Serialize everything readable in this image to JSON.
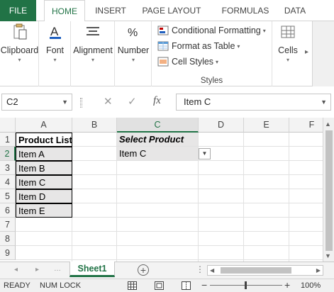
{
  "ribbon_tabs": {
    "file": "FILE",
    "home": "HOME",
    "insert": "INSERT",
    "page_layout": "PAGE LAYOUT",
    "formulas": "FORMULAS",
    "data": "DATA"
  },
  "ribbon_groups": {
    "clipboard": "Clipboard",
    "font": "Font",
    "alignment": "Alignment",
    "number": "Number",
    "conditional_formatting": "Conditional Formatting",
    "format_as_table": "Format as Table",
    "cell_styles": "Cell Styles",
    "styles": "Styles",
    "cells": "Cells"
  },
  "formula_bar": {
    "name_box": "C2",
    "formula": "Item C"
  },
  "columns": [
    "A",
    "B",
    "C",
    "D",
    "E",
    "F"
  ],
  "rows": [
    "1",
    "2",
    "3",
    "4",
    "5",
    "6",
    "7",
    "8",
    "9"
  ],
  "cells": {
    "A1": "Product List",
    "A2": "Item A",
    "A3": "Item B",
    "A4": "Item C",
    "A5": "Item D",
    "A6": "Item E",
    "C1": "Select Product",
    "C2": "Item C"
  },
  "sheet_tab": "Sheet1",
  "status_bar": {
    "mode": "READY",
    "num_lock": "NUM LOCK",
    "zoom": "100%"
  },
  "colors": {
    "accent": "#217346",
    "header_bg": "#f3f3f3",
    "cell_fill": "#e7e6e6"
  }
}
